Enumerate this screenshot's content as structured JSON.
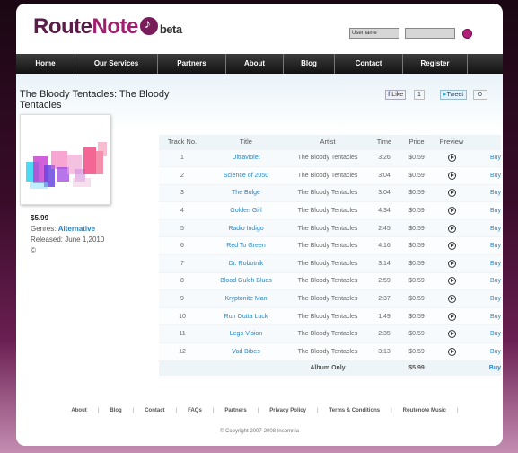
{
  "header": {
    "logo_route": "Route",
    "logo_note": "Note",
    "logo_beta": "beta",
    "username_placeholder": "Username"
  },
  "nav": {
    "items": [
      "Home",
      "Our Services",
      "Partners",
      "About",
      "Blog",
      "Contact",
      "Register"
    ]
  },
  "album": {
    "title": "The Bloody Tentacles: The Bloody Tentacles",
    "price": "$5.99",
    "genres_label": "Genres:",
    "genre": "Alternative",
    "released": "Released: June 1,2010",
    "copyright_symbol": "©"
  },
  "social": {
    "like_label": "Like",
    "like_count": "1",
    "tweet_label": "Tweet",
    "tweet_count": "0"
  },
  "table": {
    "headers": [
      "Track No.",
      "Title",
      "Artist",
      "Time",
      "Price",
      "Preview",
      ""
    ],
    "rows": [
      {
        "no": "1",
        "title": "Ultraviolet",
        "artist": "The Bloody Tentacles",
        "time": "3:26",
        "price": "$0.59",
        "buy": "Buy"
      },
      {
        "no": "2",
        "title": "Science of 2050",
        "artist": "The Bloody Tentacles",
        "time": "3:04",
        "price": "$0.59",
        "buy": "Buy"
      },
      {
        "no": "3",
        "title": "The Bulge",
        "artist": "The Bloody Tentacles",
        "time": "3:04",
        "price": "$0.59",
        "buy": "Buy"
      },
      {
        "no": "4",
        "title": "Golden Girl",
        "artist": "The Bloody Tentacles",
        "time": "4:34",
        "price": "$0.59",
        "buy": "Buy"
      },
      {
        "no": "5",
        "title": "Radio Indigo",
        "artist": "The Bloody Tentacles",
        "time": "2:45",
        "price": "$0.59",
        "buy": "Buy"
      },
      {
        "no": "6",
        "title": "Red To Green",
        "artist": "The Bloody Tentacles",
        "time": "4:16",
        "price": "$0.59",
        "buy": "Buy"
      },
      {
        "no": "7",
        "title": "Dr. Robotnik",
        "artist": "The Bloody Tentacles",
        "time": "3:14",
        "price": "$0.59",
        "buy": "Buy"
      },
      {
        "no": "8",
        "title": "Blood Gulch Blues",
        "artist": "The Bloody Tentacles",
        "time": "2:59",
        "price": "$0.59",
        "buy": "Buy"
      },
      {
        "no": "9",
        "title": "Kryptonite Man",
        "artist": "The Bloody Tentacles",
        "time": "2:37",
        "price": "$0.59",
        "buy": "Buy"
      },
      {
        "no": "10",
        "title": "Run Outta Luck",
        "artist": "The Bloody Tentacles",
        "time": "1:49",
        "price": "$0.59",
        "buy": "Buy"
      },
      {
        "no": "11",
        "title": "Lego Vision",
        "artist": "The Bloody Tentacles",
        "time": "2:35",
        "price": "$0.59",
        "buy": "Buy"
      },
      {
        "no": "12",
        "title": "Vad Bibes",
        "artist": "The Bloody Tentacles",
        "time": "3:13",
        "price": "$0.59",
        "buy": "Buy"
      }
    ],
    "album_only_label": "Album Only",
    "album_only_price": "$5.99",
    "album_only_buy": "Buy"
  },
  "footer": {
    "links": [
      "About",
      "Blog",
      "Contact",
      "FAQs",
      "Partners",
      "Privacy Policy",
      "Terms & Conditions",
      "Routenote Music"
    ],
    "copyright": "© Copyright 2007-2008 Insomnia"
  },
  "colors": {
    "brand": "#5a1d48",
    "accent": "#a0206e",
    "link": "#2a86c3"
  }
}
